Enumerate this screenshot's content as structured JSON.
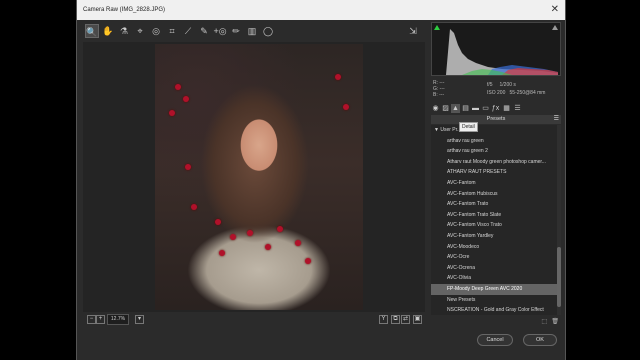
{
  "window": {
    "title": "Camera Raw (IMG_2828.JPG)"
  },
  "toolbar": {
    "tools": [
      {
        "name": "zoom-tool",
        "glyph": "🔍"
      },
      {
        "name": "hand-tool",
        "glyph": "✋"
      },
      {
        "name": "white-balance-tool",
        "glyph": "⚗"
      },
      {
        "name": "color-sampler-tool",
        "glyph": "⌖"
      },
      {
        "name": "targeted-adjustment-tool",
        "glyph": "◎"
      },
      {
        "name": "crop-tool",
        "glyph": "⌗"
      },
      {
        "name": "straighten-tool",
        "glyph": "⟋"
      },
      {
        "name": "spot-removal-tool",
        "glyph": "✎"
      },
      {
        "name": "red-eye-tool",
        "glyph": "+◎"
      },
      {
        "name": "adjustment-brush-tool",
        "glyph": "✏"
      },
      {
        "name": "graduated-filter-tool",
        "glyph": "▥"
      },
      {
        "name": "radial-filter-tool",
        "glyph": "◯"
      }
    ],
    "preferences_glyph": "⇲"
  },
  "info": {
    "r": "R:",
    "g": "G:",
    "b": "B:",
    "r_val": "---",
    "g_val": "---",
    "b_val": "---",
    "aperture": "f/5",
    "shutter": "1/200 s",
    "iso": "ISO 200",
    "lens": "55-250@84 mm"
  },
  "tabs": {
    "tooltip": "Detail"
  },
  "presets": {
    "header": "Presets",
    "items": [
      {
        "label": "User Pr...",
        "folder": true
      },
      {
        "label": "arthav rau green"
      },
      {
        "label": "arthav rau green 2"
      },
      {
        "label": "Atharv raut Moody green photoshop camer..."
      },
      {
        "label": "ATHARV RAUT PRESETS"
      },
      {
        "label": "AVC-Fantom"
      },
      {
        "label": "AVC-Fantom Hubiscus"
      },
      {
        "label": "AVC-Fantom Trato"
      },
      {
        "label": "AVC-Fantom Trato Slate"
      },
      {
        "label": "AVC-Fantom Visco Trato"
      },
      {
        "label": "AVC-Fantom Yardley"
      },
      {
        "label": "AVC-Moodeco"
      },
      {
        "label": "AVC-Ocre"
      },
      {
        "label": "AVC-Ocrena"
      },
      {
        "label": "AVC-Olivia"
      },
      {
        "label": "FP-Moody Deep Green AVC 2020",
        "selected": true
      },
      {
        "label": "New Presets"
      },
      {
        "label": "NSCREATION - Gold and Gray Color Effect"
      }
    ]
  },
  "bottom": {
    "zoom": "12.7%"
  },
  "buttons": {
    "cancel": "Cancel",
    "ok": "OK"
  },
  "colors": {
    "selected": "#646464",
    "berry": "#b0112a"
  }
}
